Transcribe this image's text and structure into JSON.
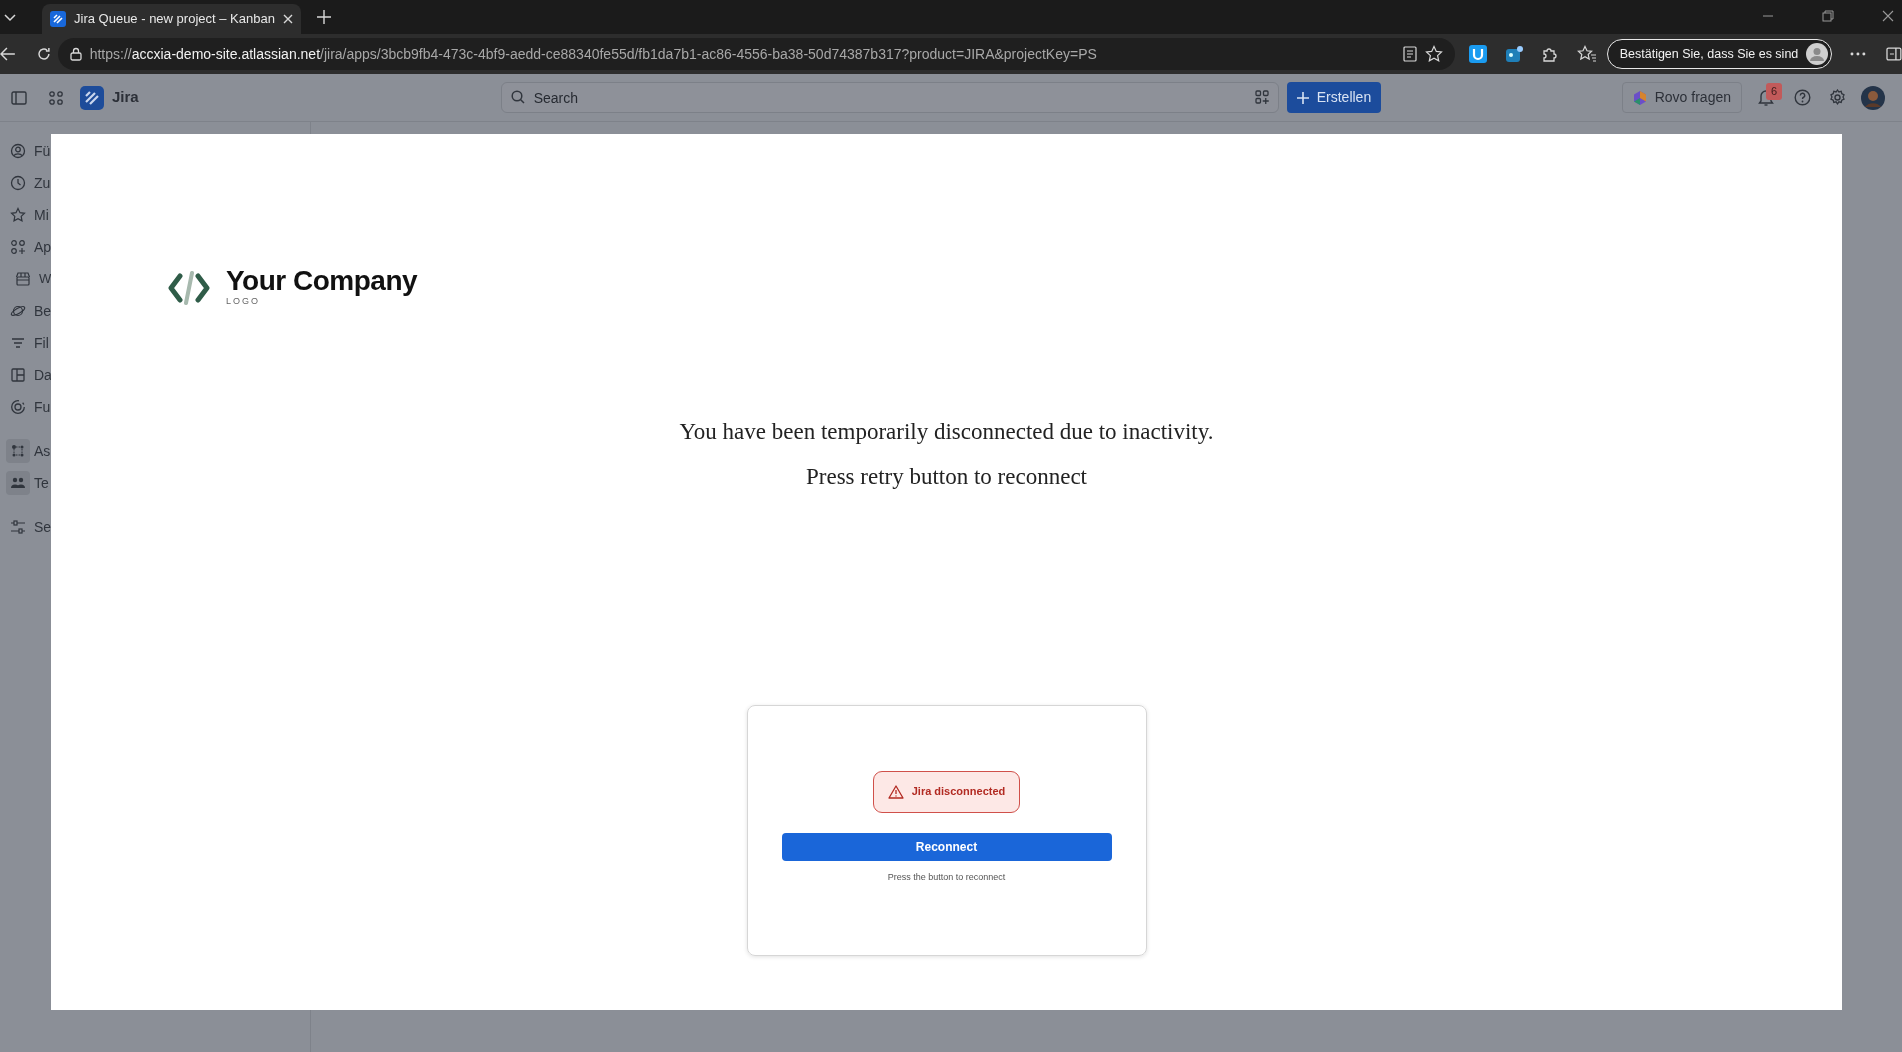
{
  "browser": {
    "tab_title": "Jira Queue - new project – Kanban",
    "url_scheme": "https://",
    "url_host": "accxia-demo-site.atlassian.net",
    "url_path": "/jira/apps/3bcb9fb4-473c-4bf9-aedd-ce88340fe55d/fb1da7b1-ac86-4556-ba38-50d74387b317?product=JIRA&projectKey=PS",
    "profile_button": "Bestätigen Sie, dass Sie es sind"
  },
  "app": {
    "name": "Jira",
    "search": {
      "placeholder": "Search"
    },
    "create_button": "Erstellen",
    "rovo_button": "Rovo fragen",
    "notification_count": "6"
  },
  "sidebar": {
    "sections": [
      {
        "items": [
          {
            "label": "Fü"
          },
          {
            "label": "Zu"
          },
          {
            "label": "Mi"
          },
          {
            "label": "Ap",
            "children": [
              {
                "label": "W"
              }
            ]
          },
          {
            "label": "Be"
          },
          {
            "label": "Fil"
          },
          {
            "label": "Da"
          },
          {
            "label": "Fu"
          }
        ]
      },
      {
        "items": [
          {
            "label": "As"
          },
          {
            "label": "Te"
          }
        ]
      },
      {
        "items": [
          {
            "label": "Se"
          }
        ]
      }
    ]
  },
  "modal": {
    "logo_name": "Your Company",
    "logo_tag": "LOGO",
    "message_lines": [
      "You have been temporarily disconnected due to inactivity.",
      "Press retry button to reconnect"
    ],
    "status": {
      "text": "Jira disconnected"
    },
    "reconnect_button": "Reconnect",
    "hint": "Press the button to reconnect"
  }
}
